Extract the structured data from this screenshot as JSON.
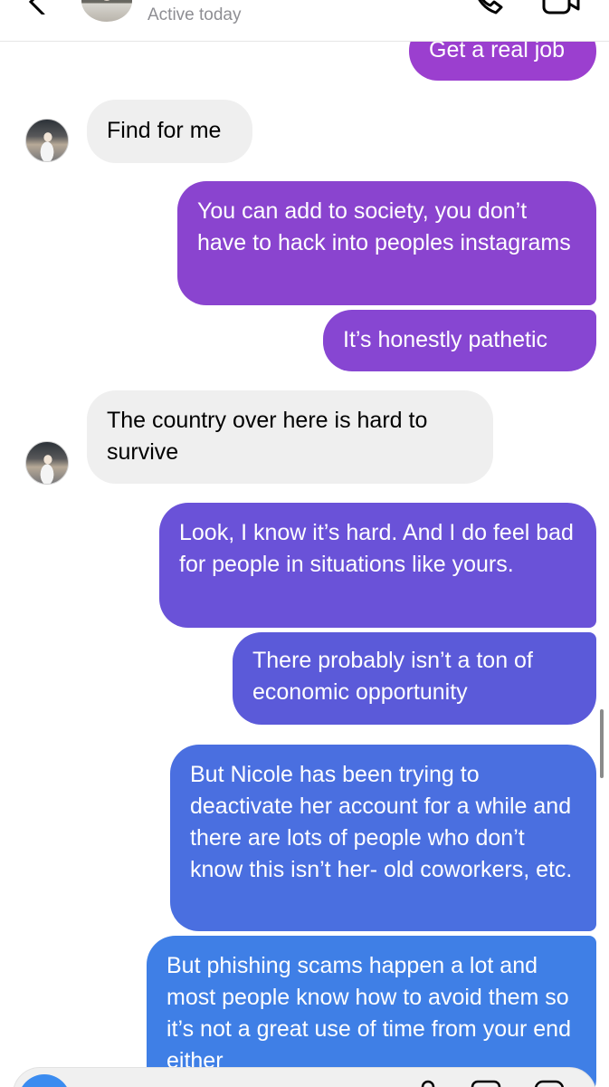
{
  "header": {
    "status": "Active today"
  },
  "messages": [
    {
      "id": "m1",
      "direction": "outgoing",
      "text": "Get a real job",
      "color": "#9b3fcf"
    },
    {
      "id": "m2",
      "direction": "incoming",
      "text": "Find for me"
    },
    {
      "id": "m3",
      "direction": "outgoing",
      "text": "You can add to society, you don’t have to hack into peoples instagrams",
      "color": "#8a44cf"
    },
    {
      "id": "m4",
      "direction": "outgoing",
      "text": "It’s honestly pathetic",
      "color": "#8746d2"
    },
    {
      "id": "m5",
      "direction": "incoming",
      "text": "The country over here is hard to survive"
    },
    {
      "id": "m6",
      "direction": "outgoing",
      "text": "Look, I know it’s hard. And I do feel bad for people in situations like yours.",
      "color": "#6a52d8"
    },
    {
      "id": "m7",
      "direction": "outgoing",
      "text": "There probably isn’t a ton of economic opportunity",
      "color": "#5b5ad9"
    },
    {
      "id": "m8",
      "direction": "outgoing",
      "text": "But Nicole has been trying to deactivate her account for a while and there are lots of people who don’t know this isn’t her- old coworkers, etc.",
      "color": "#4a6fe0"
    },
    {
      "id": "m9",
      "direction": "outgoing",
      "text": "But phishing scams happen a lot and most people know how to avoid them so it’s not a great use of time from your end either",
      "color": "#3f7fe6"
    }
  ],
  "colors": {
    "incoming_bubble": "#efefef",
    "gradient_top": "#9b3fcf",
    "gradient_bottom": "#3f7fe6"
  },
  "icons": [
    "back-icon",
    "call-icon",
    "video-icon",
    "camera-icon",
    "mic-icon",
    "gallery-icon",
    "sticker-icon"
  ]
}
